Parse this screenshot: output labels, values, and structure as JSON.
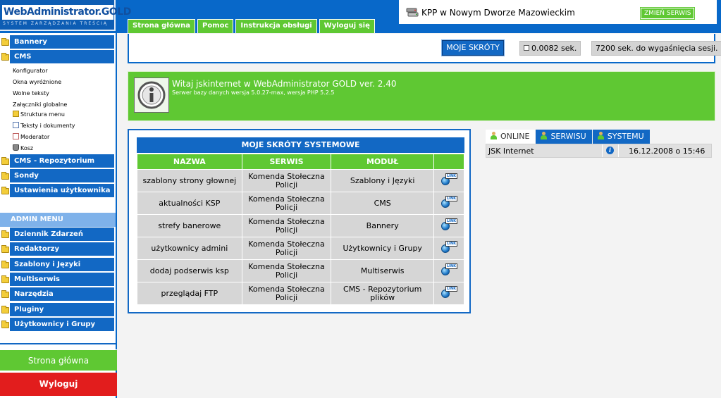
{
  "logo": {
    "name": "WebAdministrator.GOLD",
    "tagline": "SYSTEM ZARZĄDZANIA TREŚCIĄ"
  },
  "top_tabs": [
    "Strona główna",
    "Pomoc",
    "Instrukcja obsługi",
    "Wyloguj się"
  ],
  "service": {
    "name": "KPP w Nowym Dworze Mazowieckim",
    "change_label": "ZMIEŃ SERWIS"
  },
  "sidebar": {
    "top_items": [
      "Bannery",
      "CMS"
    ],
    "cms_sub": [
      "Konfigurator",
      "Okna wyróżnione",
      "Wolne teksty",
      "Załączniki globalne",
      "Struktura menu",
      "Teksty i dokumenty",
      "Moderator",
      "Kosz"
    ],
    "mid_items": [
      "CMS - Repozytorium",
      "Sondy",
      "Ustawienia użytkownika"
    ],
    "admin_header": "ADMIN MENU",
    "admin_items": [
      "Dziennik Zdarzeń",
      "Redaktorzy",
      "Szablony i Języki",
      "Multiserwis",
      "Narzędzia",
      "Pluginy",
      "Użytkownicy i Grupy"
    ],
    "home_label": "Strona główna",
    "logout_label": "Wyloguj"
  },
  "strip": {
    "shortcuts_label": "MOJE SKRÓTY",
    "gen_time": "0.0082 sek.",
    "session": "7200 sek. do wygaśnięcia sesji."
  },
  "welcome": {
    "title": "Witaj jskinternet w WebAdministrator GOLD ver. 2.40",
    "subtitle": "Serwer bazy danych wersja 5.0.27-max, wersja PHP 5.2.5"
  },
  "shortcuts_table": {
    "title": "MOJE SKRÓTY SYSTEMOWE",
    "headers": [
      "NAZWA",
      "SERWIS",
      "MODUŁ"
    ],
    "link_tag": "LINK",
    "rows": [
      {
        "name": "szablony strony głownej",
        "service": "Komenda Stołeczna Policji",
        "module": "Szablony i Języki"
      },
      {
        "name": "aktualności KSP",
        "service": "Komenda Stołeczna Policji",
        "module": "CMS"
      },
      {
        "name": "strefy banerowe",
        "service": "Komenda Stołeczna Policji",
        "module": "Bannery"
      },
      {
        "name": "użytkownicy admini",
        "service": "Komenda Stołeczna Policji",
        "module": "Użytkownicy i Grupy"
      },
      {
        "name": "dodaj podserwis ksp",
        "service": "Komenda Stołeczna Policji",
        "module": "Multiserwis"
      },
      {
        "name": "przeglądaj FTP",
        "service": "Komenda Stołeczna Policji",
        "module": "CMS - Repozytorium plików"
      }
    ]
  },
  "online": {
    "tabs": [
      "ONLINE",
      "SERWISU",
      "SYSTEMU"
    ],
    "user": "JSK Internet",
    "info_glyph": "i",
    "date": "16.12.2008 o 15:46"
  }
}
